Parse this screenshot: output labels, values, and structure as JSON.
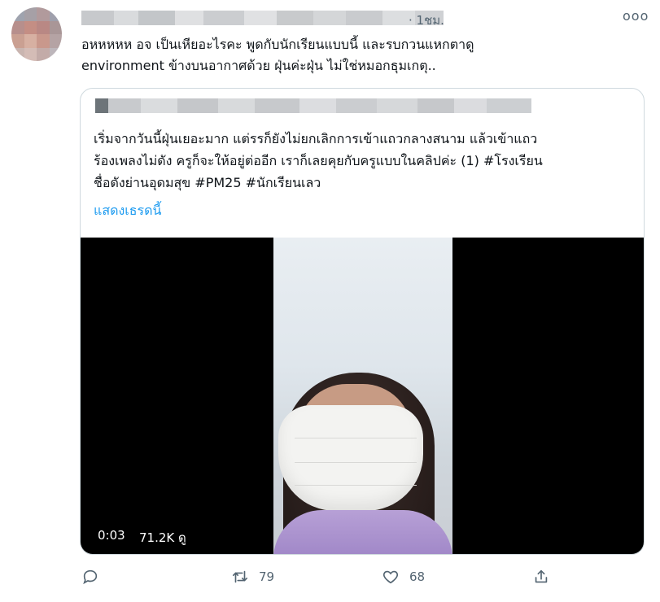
{
  "tweet": {
    "time": "· 1ชม.",
    "more_label": "ooo",
    "text": "อหหหหห อจ เป็นเหียอะไรคะ พูดกับนักเรียนแบบนี้ และรบกวนแหกตาดู\nenvironment ข้างบนอากาศด้วย ฝุ่นค่ะฝุ่น ไม่ใช่หมอกธุมเกตุ.."
  },
  "quote": {
    "text": "เริ่มจากวันนี้ฝุ่นเยอะมาก แต่รรก็ยังไม่ยกเลิกการเข้าแถวกลางสนาม แล้วเข้าแถว\nร้องเพลงไม่ดัง ครูก็จะให้อยู่ต่ออีก เราก็เลยคุยกับครูแบบในคลิปค่ะ (1) #โรงเรียน\nชื่อดังย่านอุดมสุข #PM25 #นักเรียนเลว",
    "show_thread": "แสดงเธรดนี้",
    "video": {
      "time": "0:03",
      "views": "71.2K ดู"
    }
  },
  "actions": {
    "retweets": "79",
    "likes": "68"
  },
  "colors": {
    "accent": "#1d9bf0",
    "muted": "#536471",
    "border": "#cfd9de"
  },
  "icons": [
    "reply-icon",
    "retweet-icon",
    "like-icon",
    "share-icon",
    "more-icon"
  ]
}
